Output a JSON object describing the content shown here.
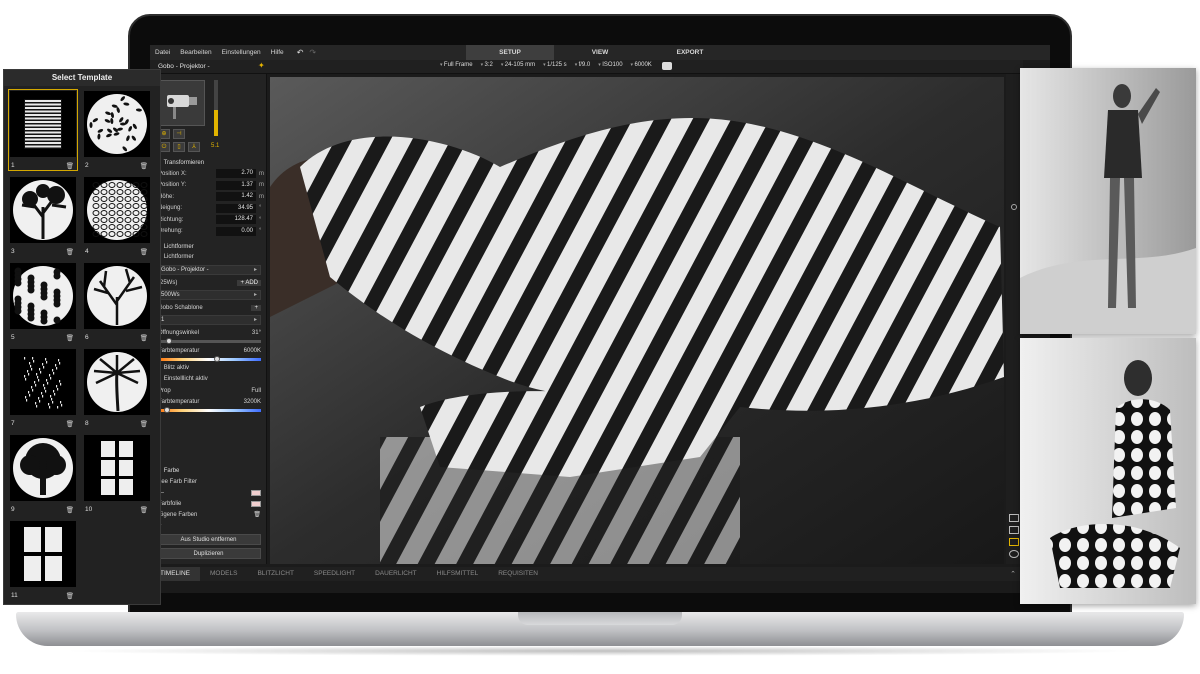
{
  "menubar": {
    "items": [
      "Datei",
      "Bearbeiten",
      "Einstellungen",
      "Hilfe"
    ],
    "undo_icon": "undo-icon",
    "redo_icon": "redo-icon",
    "tabs": [
      "SETUP",
      "VIEW",
      "EXPORT"
    ],
    "active_tab": "SETUP"
  },
  "toolbar": {
    "panel_title": "Gobo - Projektor -",
    "format": "Full Frame",
    "ratio": "3:2",
    "lens": "24-105 mm",
    "shutter": "1/125 s",
    "aperture": "f/9.0",
    "iso": "ISO100",
    "white_balance": "6000K"
  },
  "inspector": {
    "zoom_value": "5.1",
    "transform": {
      "heading": "Transformieren",
      "rows": [
        {
          "label": "Position X:",
          "value": "2.70",
          "unit": "m"
        },
        {
          "label": "Position Y:",
          "value": "1.37",
          "unit": "m"
        },
        {
          "label": "Höhe:",
          "value": "1.42",
          "unit": "m"
        },
        {
          "label": "Neigung:",
          "value": "34.95",
          "unit": "°"
        },
        {
          "label": "Richtung:",
          "value": "128.47",
          "unit": "°"
        },
        {
          "label": "Drehung:",
          "value": "0.00",
          "unit": "°"
        }
      ]
    },
    "lightformer": {
      "heading": "Lichtformer",
      "sub": "Lichtformer",
      "selected": "Gobo - Projektor -",
      "power_label": "(25Ws)",
      "add_label": "+ ADD",
      "power_select": "500Ws",
      "gobo_label": "Gobo Schablone",
      "gobo_add": "+",
      "gobo_select": "1",
      "opening_label": "Öffnungswinkel",
      "opening_value": "31°",
      "color_temp_label": "Farbtemperatur",
      "color_temp_value": "6000K",
      "color_temp_fraction": 0.55
    },
    "flash_active": "Blitz aktiv",
    "modeling_active": "Einstelllicht aktiv",
    "prop_label": "Prop",
    "full_label": "Full",
    "modeling_temp_label": "Farbtemperatur",
    "modeling_temp_value": "3200K",
    "modeling_temp_fraction": 0.08,
    "color": {
      "heading": "Farbe",
      "filter_label": "Lee Farb Filter",
      "filter_value": "—",
      "foil_label": "Farbfolie",
      "own_colors": "Eigene Farben",
      "add": "+"
    },
    "remove_button": "Aus Studio entfernen",
    "duplicate_button": "Duplizieren"
  },
  "bottom_tabs": [
    "TIMELINE",
    "MODELS",
    "BLITZLICHT",
    "SPEEDLIGHT",
    "DAUERLICHT",
    "HILFSMITTEL",
    "REQUISITEN"
  ],
  "template_panel": {
    "title": "Select Template",
    "selected": 1,
    "tiles": [
      {
        "num": "1",
        "pattern": "stripes"
      },
      {
        "num": "2",
        "pattern": "leaves-circle"
      },
      {
        "num": "3",
        "pattern": "tree-branches"
      },
      {
        "num": "4",
        "pattern": "lattice"
      },
      {
        "num": "5",
        "pattern": "foliage"
      },
      {
        "num": "6",
        "pattern": "bare-tree"
      },
      {
        "num": "7",
        "pattern": "rain"
      },
      {
        "num": "8",
        "pattern": "palm-tree"
      },
      {
        "num": "9",
        "pattern": "oak-tree"
      },
      {
        "num": "10",
        "pattern": "window-6"
      },
      {
        "num": "11",
        "pattern": "window-4"
      }
    ]
  },
  "colors": {
    "accent": "#e2b400",
    "app_bg": "#1b1b1b",
    "panel_bg": "#232323"
  }
}
